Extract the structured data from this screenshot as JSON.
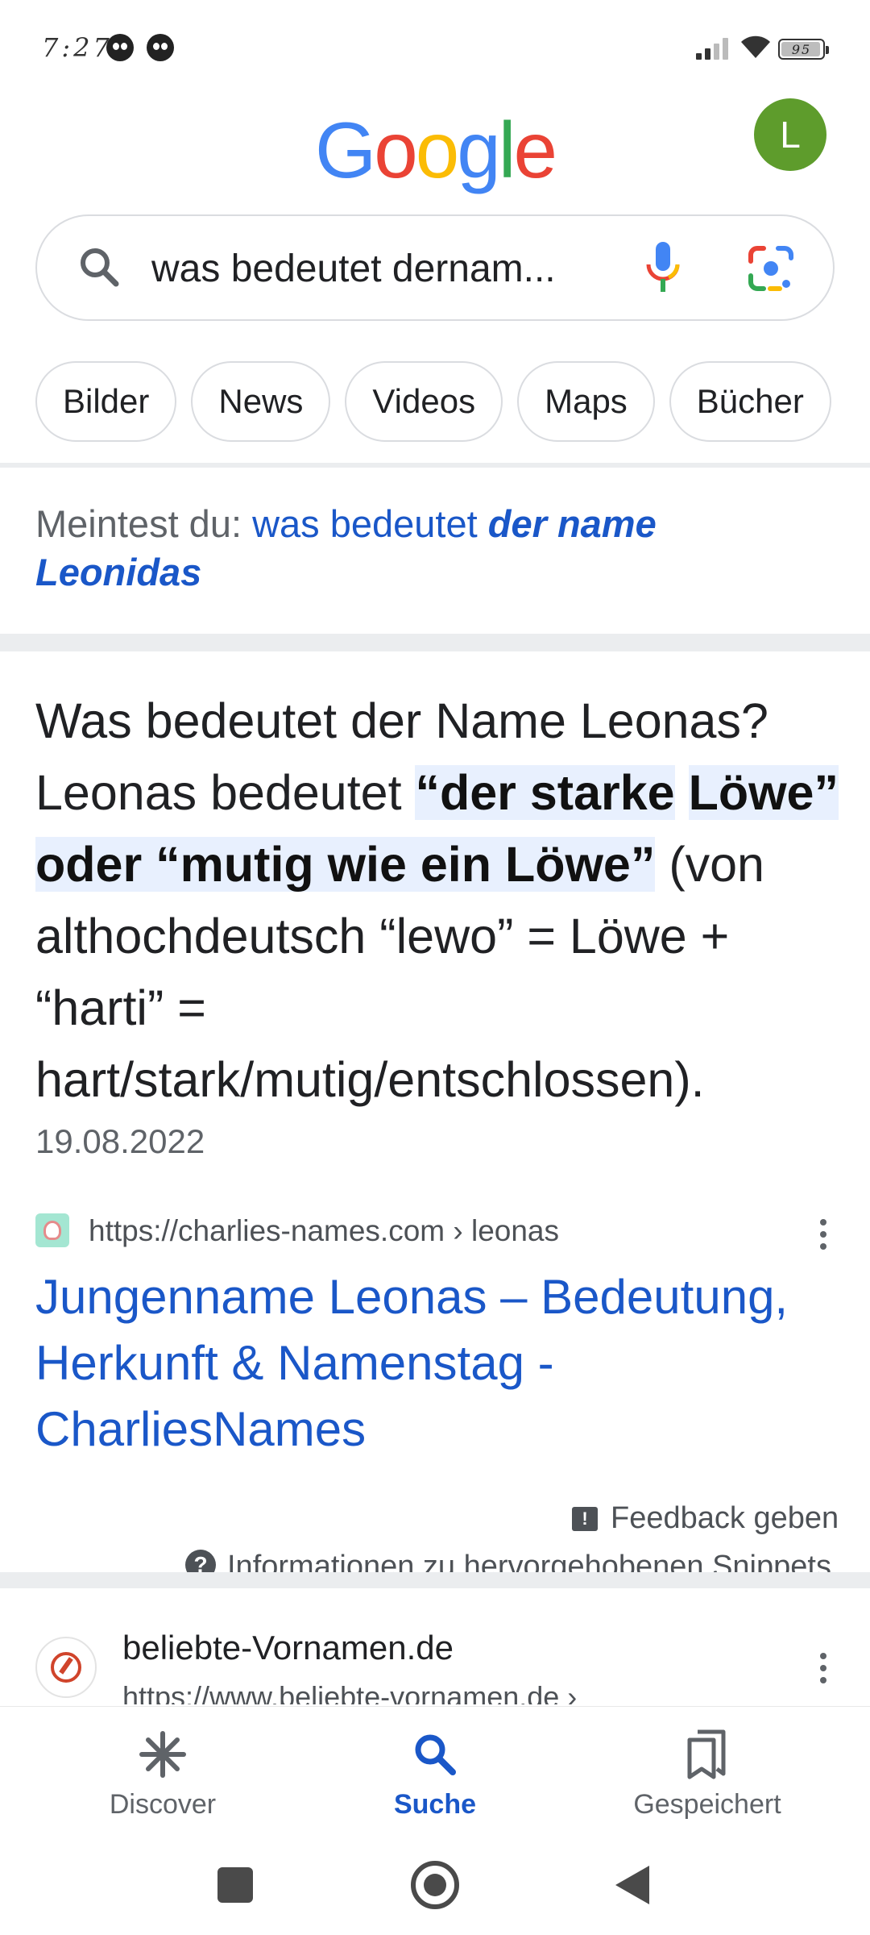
{
  "status_bar": {
    "time": "7:27",
    "battery": "95"
  },
  "header": {
    "logo_letters": [
      {
        "char": "G",
        "color": "#4285F4"
      },
      {
        "char": "o",
        "color": "#EA4335"
      },
      {
        "char": "o",
        "color": "#FBBC05"
      },
      {
        "char": "g",
        "color": "#4285F4"
      },
      {
        "char": "l",
        "color": "#34A853"
      },
      {
        "char": "e",
        "color": "#EA4335"
      }
    ],
    "avatar_initial": "L"
  },
  "search": {
    "query": "was bedeutet dernam..."
  },
  "chips": [
    "Bilder",
    "News",
    "Videos",
    "Maps",
    "Bücher"
  ],
  "did_you_mean": {
    "label": "Meintest du:",
    "link_plain": "was bedeutet",
    "link_bold_1": "der name",
    "link_bold_2": "Leonidas"
  },
  "snippet": {
    "intro": "Was bedeutet der Name Leonas? Leonas bedeutet ",
    "highlight_1": "“der starke",
    "highlight_2": "Löwe” oder “mutig wie ein Löwe”",
    "rest": "(von althochdeutsch “lewo” = Löwe + “harti” = hart/stark/mutig/entschlossen).",
    "date": "19.08.2022",
    "source_url": "https://charlies-names.com › leonas",
    "title": "Jungenname Leonas – Bedeutung, Herkunft & Namenstag - CharliesNames",
    "feedback": "Feedback geben",
    "info": "Informationen zu hervorgehobenen Snippets"
  },
  "result2": {
    "site": "beliebte-Vornamen.de",
    "url": "https://www.beliebte-vornamen.de ›"
  },
  "bottom_nav": {
    "discover": "Discover",
    "search": "Suche",
    "saved": "Gespeichert"
  },
  "colors": {
    "accent_blue": "#1a57c8",
    "avatar_green": "#5e9c2c",
    "highlight_bg": "#e8f0fe"
  }
}
